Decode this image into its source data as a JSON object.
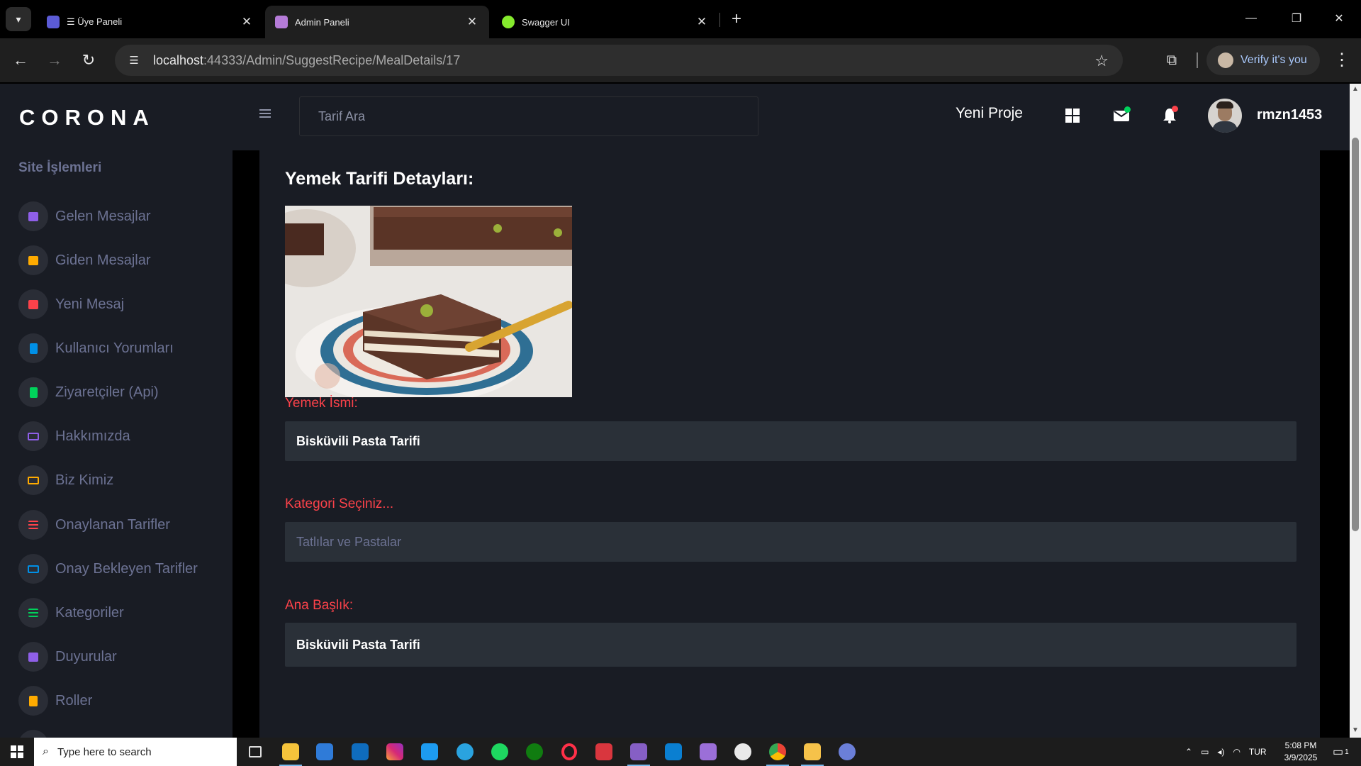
{
  "browser": {
    "tabs": [
      {
        "title": "☰ Üye Paneli",
        "favicon_color": "#5b5bd6"
      },
      {
        "title": "Admin Paneli",
        "favicon_color": "#b57bd8"
      },
      {
        "title": "Swagger UI",
        "favicon_color": "#85ea2d"
      }
    ],
    "url_host": "localhost",
    "url_path": ":44333/Admin/SuggestRecipe/MealDetails/17",
    "verify_label": "Verify it's you"
  },
  "app": {
    "brand": "CORONA",
    "sidebar": {
      "category": "Site İşlemleri",
      "items": [
        {
          "label": "Gelen Mesajlar",
          "icon": "message-icon",
          "color": "#8f5fe8"
        },
        {
          "label": "Giden Mesajlar",
          "icon": "message-icon",
          "color": "#ffab00"
        },
        {
          "label": "Yeni Mesaj",
          "icon": "message-icon",
          "color": "#fc424a"
        },
        {
          "label": "Kullanıcı Yorumları",
          "icon": "document-icon",
          "color": "#0090e7"
        },
        {
          "label": "Ziyaretçiler (Api)",
          "icon": "document-icon",
          "color": "#00d25b"
        },
        {
          "label": "Hakkımızda",
          "icon": "laptop-icon",
          "color": "#8f5fe8"
        },
        {
          "label": "Biz Kimiz",
          "icon": "laptop-icon",
          "color": "#ffab00"
        },
        {
          "label": "Onaylanan Tarifler",
          "icon": "playlist-icon",
          "color": "#fc424a"
        },
        {
          "label": "Onay Bekleyen Tarifler",
          "icon": "laptop-icon",
          "color": "#0090e7"
        },
        {
          "label": "Kategoriler",
          "icon": "playlist-add-icon",
          "color": "#00d25b"
        },
        {
          "label": "Duyurular",
          "icon": "table-icon",
          "color": "#8f5fe8"
        },
        {
          "label": "Roller",
          "icon": "contacts-icon",
          "color": "#ffab00"
        }
      ]
    },
    "navbar": {
      "search_placeholder": "Tarif Ara",
      "new_project": "Yeni Proje",
      "username": "rmzn1453"
    },
    "details": {
      "title": "Yemek Tarifi Detayları:",
      "fields": [
        {
          "label": "Yemek İsmi:",
          "value": "Bisküvili Pasta Tarifi",
          "is_placeholder": false
        },
        {
          "label": "Kategori Seçiniz...",
          "value": "Tatlılar ve Pastalar",
          "is_placeholder": true
        },
        {
          "label": "Ana Başlık:",
          "value": "Bisküvili Pasta Tarifi",
          "is_placeholder": false
        }
      ]
    }
  },
  "taskbar": {
    "search_placeholder": "Type here to search",
    "lang": "TUR",
    "time": "5:08 PM",
    "date": "3/9/2025",
    "notification_count": "1"
  }
}
